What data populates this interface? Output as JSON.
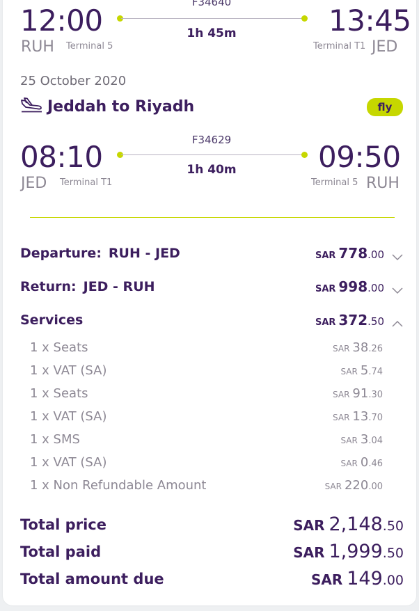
{
  "outbound": {
    "flight_no": "F34640",
    "dep_time": "12:00",
    "dep_code": "RUH",
    "dep_terminal": "Terminal 5",
    "duration": "1h 45m",
    "arr_time": "13:45",
    "arr_code": "JED",
    "arr_terminal": "Terminal T1"
  },
  "return_segment": {
    "date": "25 October 2020",
    "route_title": "Jeddah to Riyadh",
    "carrier_badge": "fly",
    "flight_no": "F34629",
    "dep_time": "08:10",
    "dep_code": "JED",
    "dep_terminal": "Terminal T1",
    "duration": "1h 40m",
    "arr_time": "09:50",
    "arr_code": "RUH",
    "arr_terminal": "Terminal 5"
  },
  "summary": {
    "departure": {
      "label": "Departure:",
      "route": "RUH - JED",
      "currency": "SAR",
      "int": "778",
      "dec": ".00"
    },
    "return": {
      "label": "Return:",
      "route": "JED - RUH",
      "currency": "SAR",
      "int": "998",
      "dec": ".00"
    },
    "services": {
      "label": "Services",
      "currency": "SAR",
      "int": "372",
      "dec": ".50"
    },
    "service_items": [
      {
        "label": "1 x Seats",
        "currency": "SAR",
        "int": "38",
        "dec": ".26"
      },
      {
        "label": "1 x VAT (SA)",
        "currency": "SAR",
        "int": "5",
        "dec": ".74"
      },
      {
        "label": "1 x Seats",
        "currency": "SAR",
        "int": "91",
        "dec": ".30"
      },
      {
        "label": "1 x VAT (SA)",
        "currency": "SAR",
        "int": "13",
        "dec": ".70"
      },
      {
        "label": "1 x SMS",
        "currency": "SAR",
        "int": "3",
        "dec": ".04"
      },
      {
        "label": "1 x VAT (SA)",
        "currency": "SAR",
        "int": "0",
        "dec": ".46"
      },
      {
        "label": "1 x Non Refundable Amount",
        "currency": "SAR",
        "int": "220",
        "dec": ".00"
      }
    ]
  },
  "totals": {
    "total_price": {
      "label": "Total price",
      "currency": "SAR",
      "int": "2,148",
      "dec": ".50"
    },
    "total_paid": {
      "label": "Total paid",
      "currency": "SAR",
      "int": "1,999",
      "dec": ".50"
    },
    "total_due": {
      "label": "Total amount due",
      "currency": "SAR",
      "int": "149",
      "dec": ".00"
    }
  },
  "colors": {
    "brand_purple": "#3c1e5e",
    "accent_lime": "#c6d700",
    "muted_text": "#8d8894"
  },
  "icons": {
    "route_icon": "plane-landing-icon",
    "collapse": "chevron-down-icon",
    "expand": "chevron-up-icon"
  }
}
